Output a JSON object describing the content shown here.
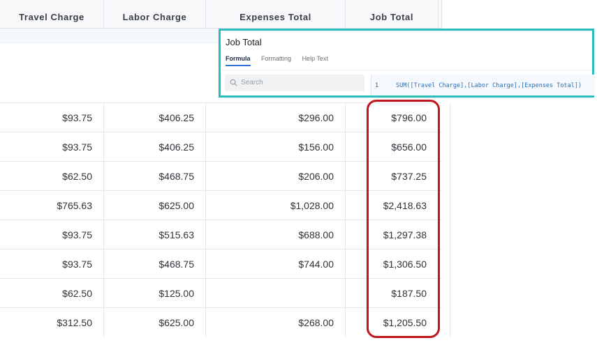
{
  "columns": {
    "travel": "Travel Charge",
    "labor": "Labor Charge",
    "expenses": "Expenses Total",
    "job": "Job Total"
  },
  "rows": [
    {
      "travel": "$93.75",
      "labor": "$406.25",
      "expenses": "$296.00",
      "job": "$796.00"
    },
    {
      "travel": "$93.75",
      "labor": "$406.25",
      "expenses": "$156.00",
      "job": "$656.00"
    },
    {
      "travel": "$62.50",
      "labor": "$468.75",
      "expenses": "$206.00",
      "job": "$737.25"
    },
    {
      "travel": "$765.63",
      "labor": "$625.00",
      "expenses": "$1,028.00",
      "job": "$2,418.63"
    },
    {
      "travel": "$93.75",
      "labor": "$515.63",
      "expenses": "$688.00",
      "job": "$1,297.38"
    },
    {
      "travel": "$93.75",
      "labor": "$468.75",
      "expenses": "$744.00",
      "job": "$1,306.50"
    },
    {
      "travel": "$62.50",
      "labor": "$125.00",
      "expenses": "",
      "job": "$187.50"
    },
    {
      "travel": "$312.50",
      "labor": "$625.00",
      "expenses": "$268.00",
      "job": "$1,205.50"
    }
  ],
  "panel": {
    "title": "Job Total",
    "tabs": [
      "Formula",
      "Formatting",
      "Help Text"
    ],
    "active_tab": "Formula",
    "search_placeholder": "Search",
    "line_number": "1",
    "formula": "SUM([Travel Charge],[Labor Charge],[Expenses Total])"
  },
  "colors": {
    "panel_border": "#2bbcbc",
    "highlight_border": "#c0151a",
    "formula_text": "#2a6fb8",
    "active_tab_underline": "#2f6fd6"
  }
}
